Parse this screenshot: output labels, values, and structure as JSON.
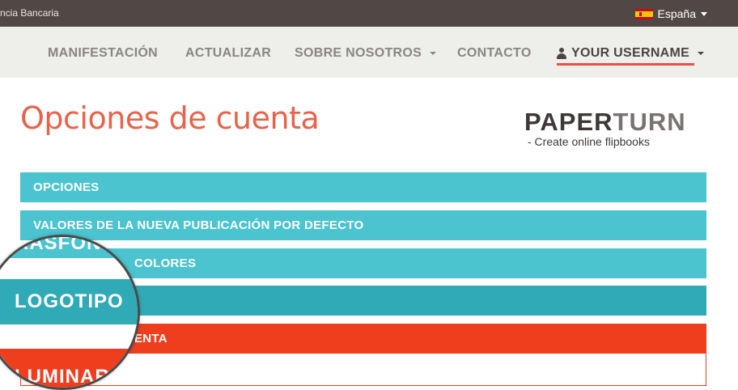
{
  "topbar": {
    "left_text": "ncia Bancaria",
    "language": "España",
    "colors": {
      "background": "#514845"
    }
  },
  "nav": {
    "items": [
      "MANIFESTACIÓN",
      "ACTUALIZAR",
      "SOBRE NOSOTROS",
      "CONTACTO"
    ],
    "user_label": "YOUR USERNAME",
    "icons": {
      "user": "user-icon",
      "dropdown": "caret-down-icon",
      "flag": "spain-flag-icon"
    }
  },
  "page": {
    "title": "Opciones de cuenta",
    "title_color": "#e8634b"
  },
  "logo": {
    "part1": "PAPER",
    "part2": "TURN",
    "tagline": "- Create online flipbooks"
  },
  "accordion": {
    "items": [
      "OPCIONES",
      "VALORES DE LA NUEVA PUBLICACIÓN POR DEFECTO",
      "COLORES",
      "",
      "ENTA"
    ],
    "colors": {
      "teal": "#4bc4cf",
      "teal_active": "#30aab6",
      "red": "#ee3e1e"
    }
  },
  "magnifier": {
    "top_text": "RASFON",
    "main_text": "LOGOTIPO",
    "bottom_text": "LUMINAR"
  }
}
